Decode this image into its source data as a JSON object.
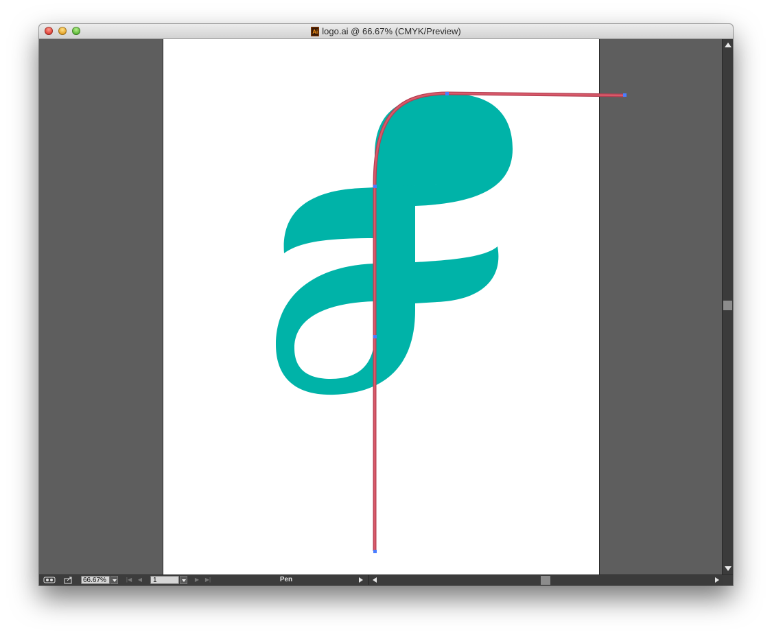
{
  "window": {
    "title": "logo.ai @ 66.67% (CMYK/Preview)",
    "file_icon_label": "Ai",
    "file_icon": "illustrator-file-icon"
  },
  "artwork": {
    "glyph_color": "#00b3a8",
    "path_color": "#cf4a5c",
    "anchor_color": "#4a7dff"
  },
  "statusbar": {
    "zoom": "66.67%",
    "page": "1",
    "current_tool": "Pen"
  }
}
